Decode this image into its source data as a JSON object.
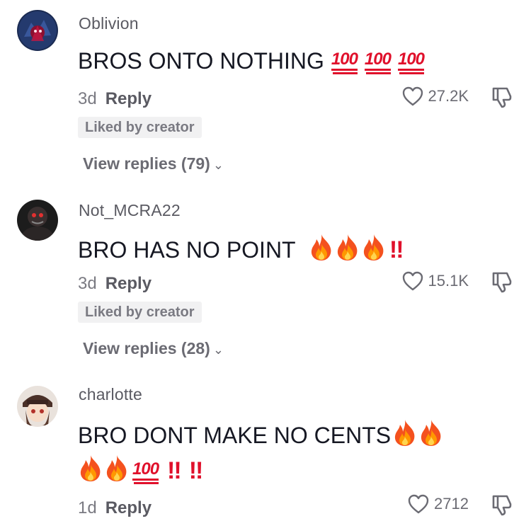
{
  "comments": [
    {
      "username": "Oblivion",
      "text": "BROS ONTO NOTHING",
      "emoji_100": [
        "100",
        "100",
        "100"
      ],
      "age": "3d",
      "reply_label": "Reply",
      "likes": "27.2K",
      "liked_by_creator": "Liked by creator",
      "view_replies": "View replies (79)"
    },
    {
      "username": "Not_MCRA22",
      "text": "BRO HAS NO POINT",
      "bang": "!!",
      "age": "3d",
      "reply_label": "Reply",
      "likes": "15.1K",
      "liked_by_creator": "Liked by creator",
      "view_replies": "View replies (28)"
    },
    {
      "username": "charlotte",
      "text": "BRO DONT MAKE NO CENTS",
      "emoji_100": "100",
      "bang1": "!!",
      "bang2": "!!",
      "age": "1d",
      "reply_label": "Reply",
      "likes": "2712"
    }
  ],
  "icons": {
    "like": "heart-outline-icon",
    "dislike": "thumbs-down-icon",
    "fire": "fire-emoji",
    "hundred": "hundred-points-emoji"
  },
  "colors": {
    "emoji_red": "#e0102b",
    "meta_gray": "#7a7a82",
    "text": "#161823"
  }
}
